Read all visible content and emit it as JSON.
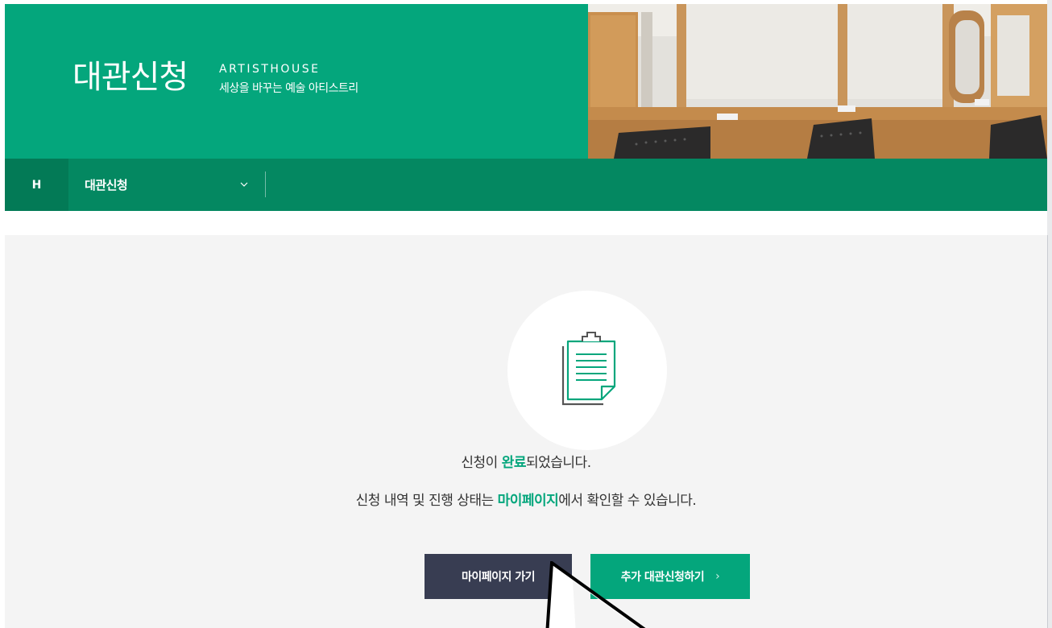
{
  "hero": {
    "title": "대관신청",
    "brand": "ARTISTHOUSE",
    "subtitle": "세상을 바꾸는 예술 아티스트리"
  },
  "nav": {
    "home_label": "H",
    "menu_label": "대관신청"
  },
  "result": {
    "line1_before": "신청이 ",
    "line1_highlight": "완료",
    "line1_after": "되었습니다.",
    "line2_before": "신청 내역 및 진행 상태는 ",
    "line2_highlight": "마이페이지",
    "line2_after": "에서 확인할 수 있습니다."
  },
  "buttons": {
    "mypage_label": "마이페이지 가기",
    "more_label": "추가 대관신청하기",
    "more_chevron": "›"
  },
  "colors": {
    "brand_green": "#04a67c",
    "nav_green": "#048861",
    "dark_button": "#383d52"
  }
}
